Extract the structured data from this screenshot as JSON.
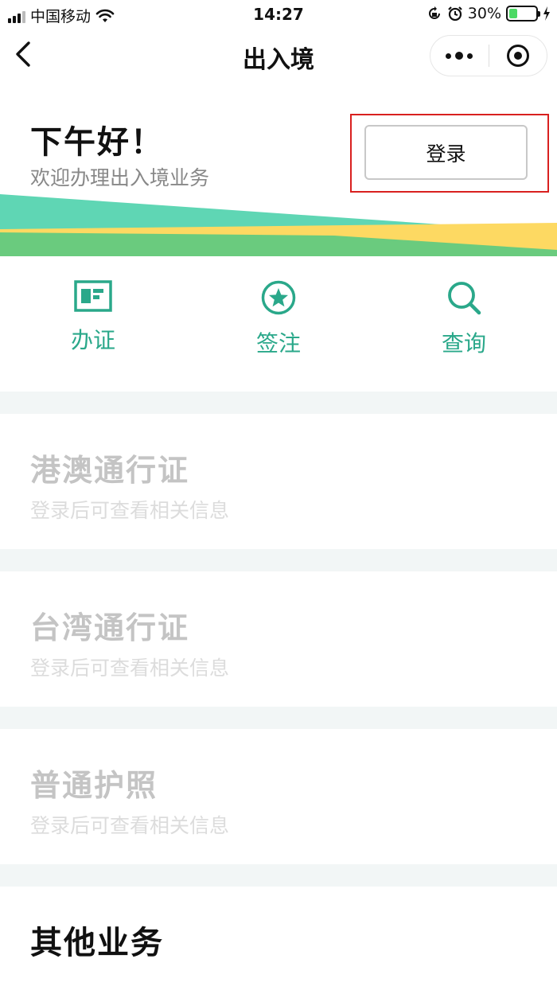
{
  "status_bar": {
    "carrier": "中国移动",
    "time": "14:27",
    "battery_percent_text": "30%",
    "battery_level": 0.3
  },
  "nav": {
    "title": "出入境"
  },
  "header": {
    "greeting": "下午好！",
    "subtitle": "欢迎办理出入境业务",
    "login_label": "登录"
  },
  "actions": [
    {
      "label": "办证",
      "icon": "id-card-icon"
    },
    {
      "label": "签注",
      "icon": "star-circle-icon"
    },
    {
      "label": "查询",
      "icon": "search-icon"
    }
  ],
  "cards": [
    {
      "title": "港澳通行证",
      "subtitle": "登录后可查看相关信息"
    },
    {
      "title": "台湾通行证",
      "subtitle": "登录后可查看相关信息"
    },
    {
      "title": "普通护照",
      "subtitle": "登录后可查看相关信息"
    }
  ],
  "other": {
    "title": "其他业务"
  },
  "colors": {
    "accent": "#2aa88a",
    "highlight_border": "#d9201f",
    "wave_teal": "#5fd6b4",
    "wave_green": "#6acb7e",
    "wave_yellow": "#fdd962"
  }
}
